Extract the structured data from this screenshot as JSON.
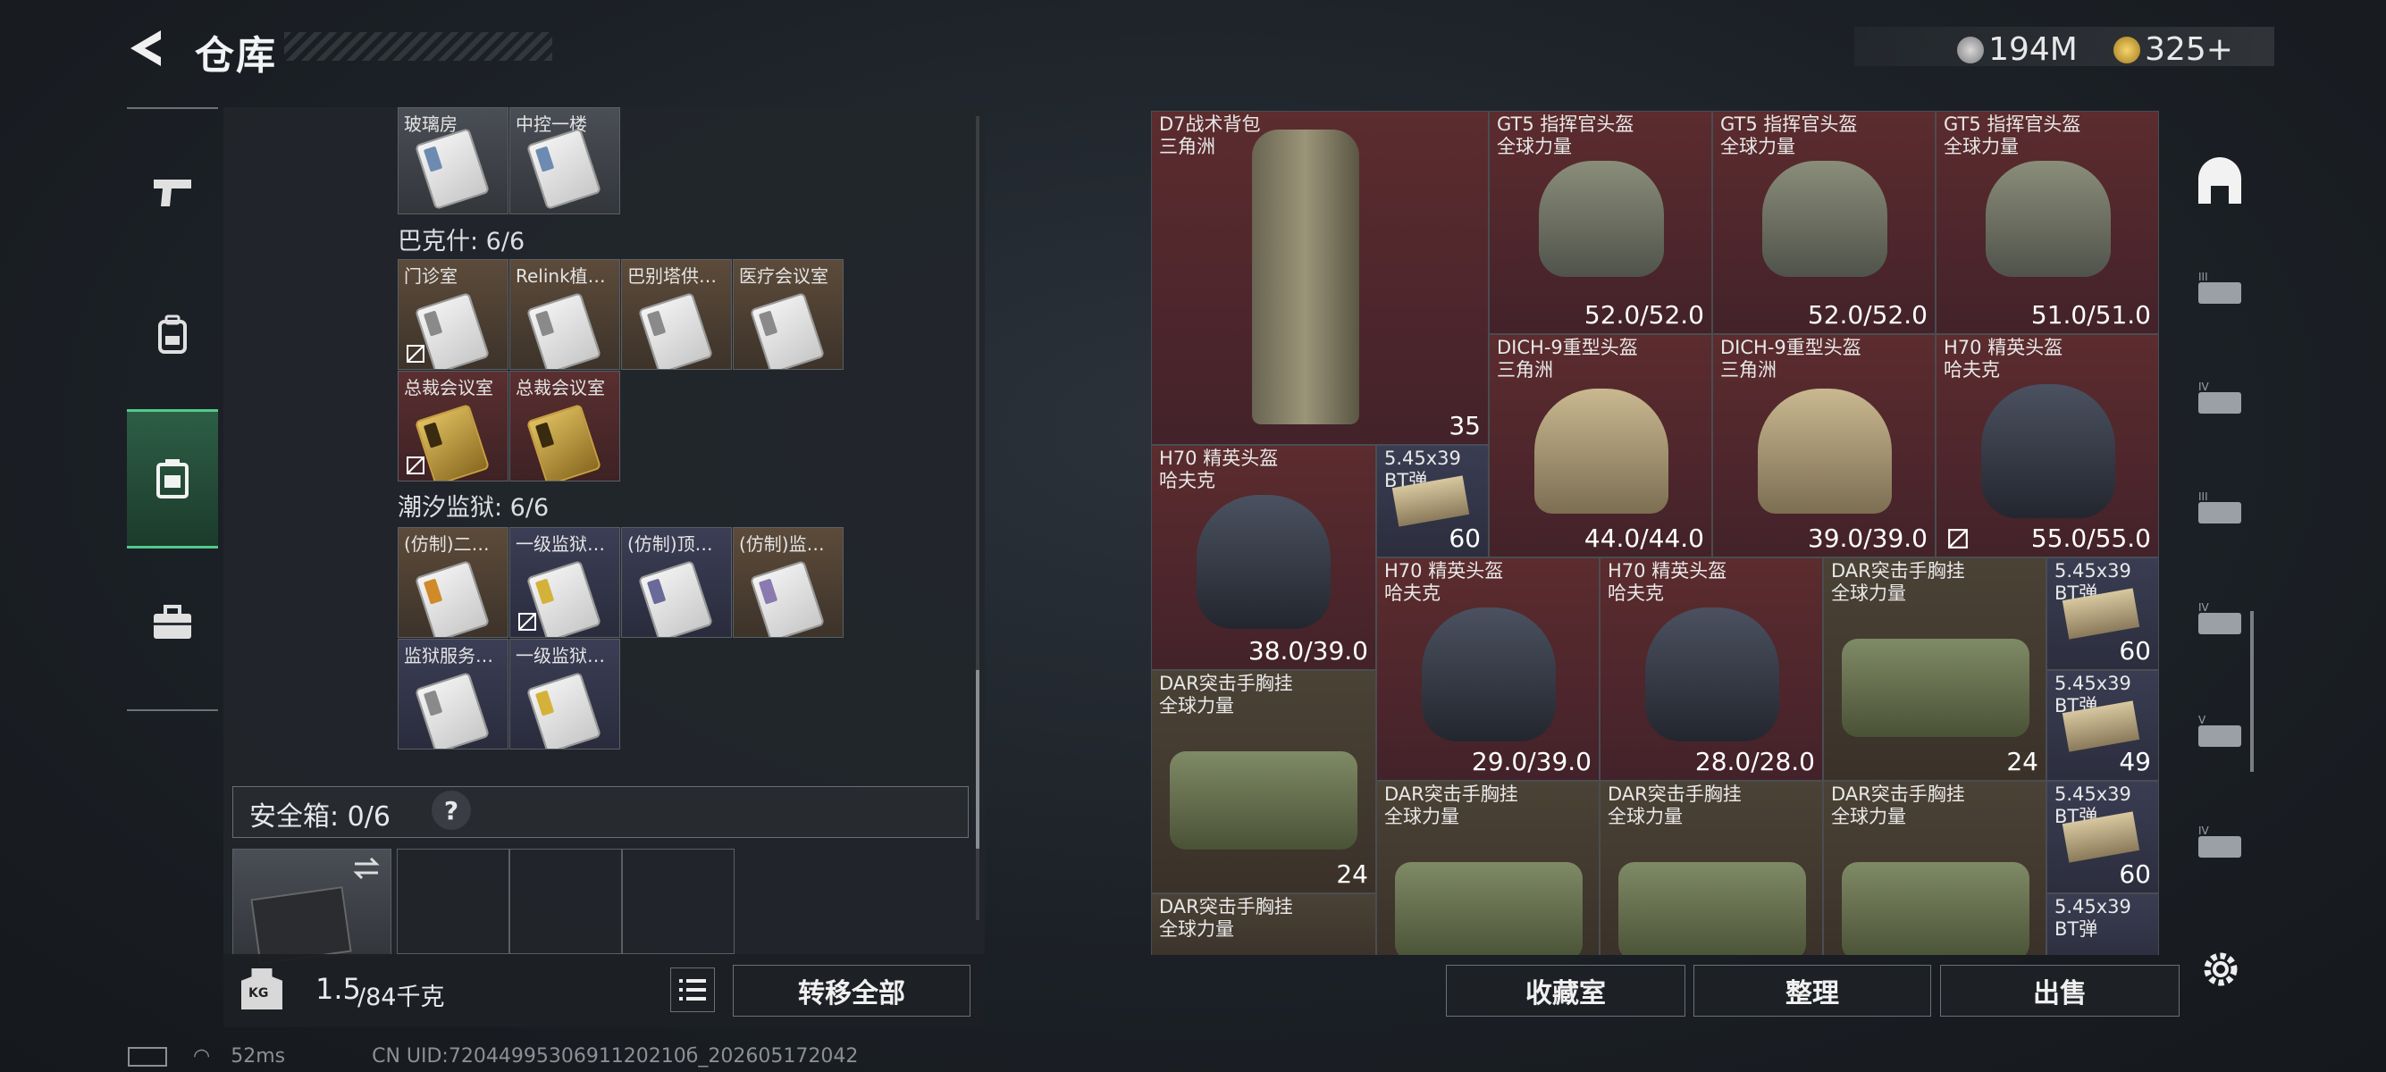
{
  "header": {
    "title": "仓库",
    "currencies": [
      {
        "icon": "silver-coin-icon",
        "value": "194M"
      },
      {
        "icon": "gold-coin-icon",
        "value": "325+"
      }
    ]
  },
  "left_nav": [
    {
      "icon": "pistol-icon",
      "active": false
    },
    {
      "icon": "backpack-icon",
      "active": false
    },
    {
      "icon": "keycard-case-icon",
      "active": true
    },
    {
      "icon": "toolbox-icon",
      "active": false
    }
  ],
  "keys_panel": {
    "top_row": [
      {
        "label": "玻璃房"
      },
      {
        "label": "中控一楼"
      }
    ],
    "sections": [
      {
        "title": "巴克什: 6/6",
        "rows": [
          [
            {
              "label": "门诊室",
              "color": "brown",
              "card": "white",
              "nosell": true
            },
            {
              "label": "Relink植…",
              "color": "brown",
              "card": "white",
              "nosell": false
            },
            {
              "label": "巴别塔供…",
              "color": "brown",
              "card": "white",
              "nosell": false
            },
            {
              "label": "医疗会议室",
              "color": "brown",
              "card": "white",
              "nosell": false
            }
          ],
          [
            {
              "label": "总裁会议室",
              "color": "red",
              "card": "gold",
              "nosell": true
            },
            {
              "label": "总裁会议室",
              "color": "red",
              "card": "gold",
              "nosell": false
            }
          ]
        ]
      },
      {
        "title": "潮汐监狱: 6/6",
        "rows": [
          [
            {
              "label": "(仿制)二…",
              "color": "brown",
              "card": "white",
              "nosell": false
            },
            {
              "label": "一级监狱…",
              "color": "blue",
              "card": "white",
              "nosell": true
            },
            {
              "label": "(仿制)顶…",
              "color": "blue",
              "card": "white",
              "nosell": false
            },
            {
              "label": "(仿制)监…",
              "color": "brown",
              "card": "white",
              "nosell": false
            }
          ],
          [
            {
              "label": "监狱服务…",
              "color": "blue",
              "card": "white",
              "nosell": false
            },
            {
              "label": "一级监狱…",
              "color": "blue",
              "card": "white",
              "nosell": false
            }
          ]
        ]
      }
    ],
    "safebox": {
      "label": "安全箱: 0/6",
      "help": "?"
    }
  },
  "footer_left": {
    "weight_current": "1.5",
    "weight_max": "/84千克",
    "weight_icon": "KG",
    "transfer_all": "转移全部"
  },
  "inventory": [
    {
      "name": "D7战术背包",
      "sub": "三角洲",
      "value": "35",
      "bg": "red"
    },
    {
      "name": "GT5 指挥官头盔",
      "sub": "全球力量",
      "value": "52.0/52.0",
      "bg": "red"
    },
    {
      "name": "GT5 指挥官头盔",
      "sub": "全球力量",
      "value": "52.0/52.0",
      "bg": "red"
    },
    {
      "name": "GT5 指挥官头盔",
      "sub": "全球力量",
      "value": "51.0/51.0",
      "bg": "red"
    },
    {
      "name": "DICH-9重型头盔",
      "sub": "三角洲",
      "value": "44.0/44.0",
      "bg": "red"
    },
    {
      "name": "DICH-9重型头盔",
      "sub": "三角洲",
      "value": "39.0/39.0",
      "bg": "red"
    },
    {
      "name": "H70 精英头盔",
      "sub": "哈夫克",
      "value": "55.0/55.0",
      "bg": "red"
    },
    {
      "name": "H70 精英头盔",
      "sub": "哈夫克",
      "value": "38.0/39.0",
      "bg": "red"
    },
    {
      "name": "5.45x39",
      "sub": "BT弹",
      "value": "60",
      "bg": "blue"
    },
    {
      "name": "H70 精英头盔",
      "sub": "哈夫克",
      "value": "29.0/39.0",
      "bg": "red"
    },
    {
      "name": "H70 精英头盔",
      "sub": "哈夫克",
      "value": "28.0/28.0",
      "bg": "red"
    },
    {
      "name": "DAR突击手胸挂",
      "sub": "全球力量",
      "value": "24",
      "bg": "brown"
    },
    {
      "name": "5.45x39",
      "sub": "BT弹",
      "value": "60",
      "bg": "blue"
    },
    {
      "name": "5.45x39",
      "sub": "BT弹",
      "value": "49",
      "bg": "blue"
    },
    {
      "name": "DAR突击手胸挂",
      "sub": "全球力量",
      "value": "24",
      "bg": "brown"
    },
    {
      "name": "DAR突击手胸挂",
      "sub": "全球力量",
      "value": "",
      "bg": "brown"
    },
    {
      "name": "DAR突击手胸挂",
      "sub": "全球力量",
      "value": "",
      "bg": "brown"
    },
    {
      "name": "DAR突击手胸挂",
      "sub": "全球力量",
      "value": "",
      "bg": "brown"
    },
    {
      "name": "5.45x39",
      "sub": "BT弹",
      "value": "60",
      "bg": "blue"
    },
    {
      "name": "DAR突击手胸挂",
      "sub": "全球力量",
      "value": "",
      "bg": "brown"
    },
    {
      "name": "5.45x39",
      "sub": "BT弹",
      "value": "",
      "bg": "blue"
    }
  ],
  "right_buttons": {
    "collection": "收藏室",
    "sort": "整理",
    "sell": "出售"
  },
  "right_side_icons": [
    "home-icon",
    "tier-3-gun-case-icon",
    "tier-4-folder-icon",
    "tier-3-safe-icon",
    "tier-4-case-icon",
    "tier-5-safe-icon",
    "tier-4-folder-2-icon",
    "settings-icon"
  ],
  "status_bar": {
    "ping": "52ms",
    "uid": "CN UID:7204499530691120210б_202605172042"
  }
}
